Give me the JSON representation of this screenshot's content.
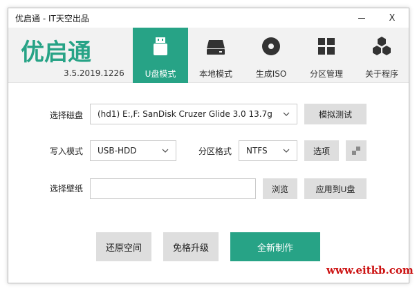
{
  "window": {
    "title": "优启通 - IT天空出品",
    "minimize_icon": "minimize-icon",
    "close_symbol": "X"
  },
  "header": {
    "logo_text": "优启通",
    "version": "3.5.2019.1226",
    "accent_color": "#27a386",
    "tabs": [
      {
        "label": "U盘模式",
        "icon": "usb-drive-icon",
        "active": true
      },
      {
        "label": "本地模式",
        "icon": "hard-disk-icon",
        "active": false
      },
      {
        "label": "生成ISO",
        "icon": "disc-icon",
        "active": false
      },
      {
        "label": "分区管理",
        "icon": "partition-grid-icon",
        "active": false
      },
      {
        "label": "关于程序",
        "icon": "about-hexagons-icon",
        "active": false
      }
    ]
  },
  "form": {
    "disk_label": "选择磁盘",
    "disk_value": "(hd1) E:,F: SanDisk Cruzer Glide 3.0 13.7g",
    "simulate_button": "模拟测试",
    "write_mode_label": "写入模式",
    "write_mode_value": "USB-HDD",
    "partition_format_label": "分区格式",
    "partition_format_value": "NTFS",
    "options_button": "选项",
    "wallpaper_label": "选择壁纸",
    "wallpaper_value": "",
    "browse_button": "浏览",
    "apply_button": "应用到U盘"
  },
  "actions": {
    "restore_button": "还原空间",
    "upgrade_button": "免格升级",
    "create_button": "全新制作"
  },
  "watermark": "www.eitkb.com"
}
